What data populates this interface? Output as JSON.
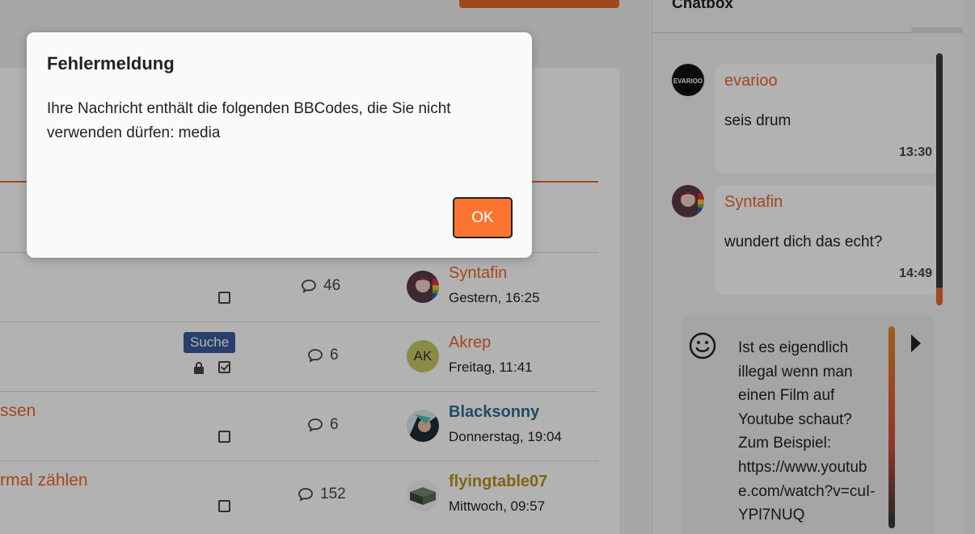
{
  "modal": {
    "title": "Fehlermeldung",
    "message": "Ihre Nachricht enthält die folgenden BBCodes, die Sie nicht verwenden dürfen: media",
    "ok_label": "OK"
  },
  "forum": {
    "partial_text": "n",
    "rows": [
      {
        "title": "",
        "replies": "46",
        "last_user": "Syntafin",
        "last_time": "Gestern, 16:25"
      },
      {
        "title": "",
        "tag": "Suche",
        "replies": "6",
        "last_user": "Akrep",
        "avatar_initials": "AK",
        "last_time": "Freitag, 11:41"
      },
      {
        "title": "ssen",
        "replies": "6",
        "last_user": "Blacksonny",
        "last_time": "Donnerstag, 19:04"
      },
      {
        "title": "rmal zählen",
        "replies": "152",
        "last_user": "flyingtable07",
        "last_time": "Mittwoch, 09:57"
      }
    ]
  },
  "chat": {
    "header": "Chatbox",
    "messages": [
      {
        "user": "evarioo",
        "text": "seis drum",
        "time": "13:30",
        "avatar_text": "EVARIOO"
      },
      {
        "user": "Syntafin",
        "text": "wundert dich das echt?",
        "time": "14:49"
      }
    ],
    "compose_text": "Ist es eigendlich illegal wenn man einen Film auf Youtube schaut? Zum Beispiel: https://www.youtube.com/watch?v=cuI-YPl7NUQ"
  },
  "colors": {
    "accent": "#e8662a",
    "ok_button": "#fb7430",
    "tag": "#3a5a9a",
    "blacksonny": "#2e6d8e",
    "flyingtable": "#b8901c"
  }
}
